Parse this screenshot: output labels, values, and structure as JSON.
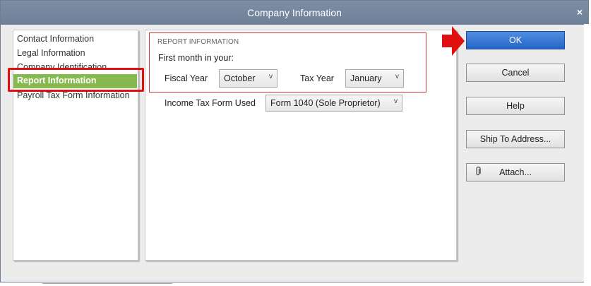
{
  "window": {
    "title": "Company Information",
    "close_symbol": "×"
  },
  "sidebar": {
    "items": [
      {
        "label": "Contact Information"
      },
      {
        "label": "Legal Information"
      },
      {
        "label": "Company Identification"
      },
      {
        "label": "Report Information"
      },
      {
        "label": "Payroll Tax Form Information"
      }
    ],
    "selected_index": 3
  },
  "report": {
    "heading": "REPORT INFORMATION",
    "first_month_label": "First month in your:",
    "fiscal_year_label": "Fiscal Year",
    "fiscal_year_value": "October",
    "tax_year_label": "Tax Year",
    "tax_year_value": "January",
    "income_tax_form_label": "Income Tax Form Used",
    "income_tax_form_value": "Form 1040 (Sole Proprietor)"
  },
  "buttons": {
    "ok": "OK",
    "cancel": "Cancel",
    "help": "Help",
    "ship_to_address": "Ship To Address...",
    "attach": "Attach..."
  },
  "icons": {
    "dropdown": "v",
    "paperclip": "paperclip-icon"
  },
  "colors": {
    "accent_green": "#86b94e",
    "highlight_red": "#e01010",
    "ok_blue": "#2f6fd0",
    "title_bar": "#7589a0"
  }
}
